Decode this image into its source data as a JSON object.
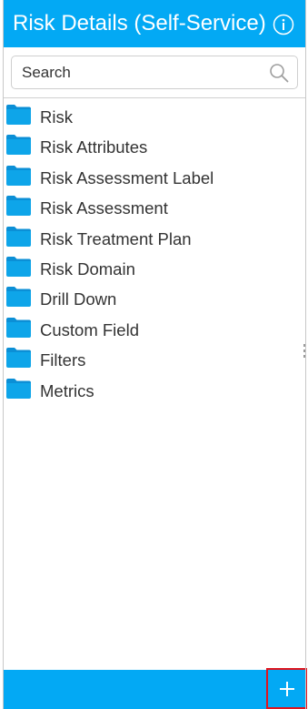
{
  "header": {
    "title": "Risk Details (Self-Service)",
    "info_icon": "info-icon"
  },
  "search": {
    "placeholder": "Search",
    "value": "",
    "icon": "search-icon"
  },
  "tree": {
    "items": [
      {
        "label": "Risk",
        "icon": "folder-icon"
      },
      {
        "label": "Risk Attributes",
        "icon": "folder-icon"
      },
      {
        "label": "Risk Assessment Label",
        "icon": "folder-icon"
      },
      {
        "label": "Risk Assessment",
        "icon": "folder-icon"
      },
      {
        "label": "Risk Treatment Plan",
        "icon": "folder-icon"
      },
      {
        "label": "Risk Domain",
        "icon": "folder-icon"
      },
      {
        "label": "Drill Down",
        "icon": "folder-icon"
      },
      {
        "label": "Custom Field",
        "icon": "folder-icon"
      },
      {
        "label": "Filters",
        "icon": "folder-icon"
      },
      {
        "label": "Metrics",
        "icon": "folder-icon"
      }
    ]
  },
  "footer": {
    "add_icon": "plus-icon"
  },
  "colors": {
    "accent": "#03a9f4",
    "folder": "#0ea5e9",
    "text": "#333333",
    "highlight_border": "#e0141e"
  }
}
